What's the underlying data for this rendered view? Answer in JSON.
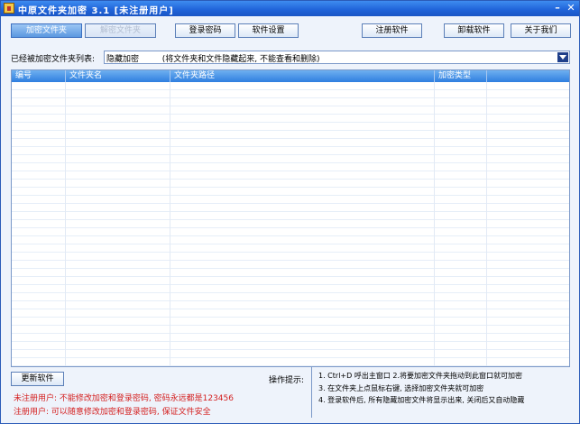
{
  "window": {
    "title": "中原文件夹加密 3.1 [未注册用户]"
  },
  "toolbar": {
    "encrypt_folder": "加密文件夹",
    "decrypt_folder": "解密文件夹",
    "login_password": "登录密码",
    "software_settings": "软件设置",
    "register": "注册软件",
    "uninstall": "卸载软件",
    "about": "关于我们"
  },
  "list_label": "已经被加密文件夹列表:",
  "mode_select": {
    "value": "隐藏加密         (将文件夹和文件隐藏起来, 不能查看和删除)"
  },
  "table": {
    "columns": [
      "编号",
      "文件夹名",
      "文件夹路径",
      "加密类型"
    ]
  },
  "update_button": "更新软件",
  "notes": {
    "unregistered": "未注册用户: 不能修改加密和登录密码, 密码永远都是123456",
    "registered": "注册用户:   可以随意修改加密和登录密码, 保证文件安全"
  },
  "hints": {
    "title": "操作提示:",
    "lines": [
      "1. Ctrl+D 呼出主窗口 2.将要加密文件夹拖动到此窗口就可加密",
      "3. 在文件夹上点鼠标右键, 选择加密文件夹就可加密",
      "4. 登录软件后, 所有隐藏加密文件将显示出来, 关闭后又自动隐藏"
    ]
  },
  "colors": {
    "title_bar": "#1f62d8",
    "header": "#2f7ee0",
    "warning": "#d42020"
  }
}
